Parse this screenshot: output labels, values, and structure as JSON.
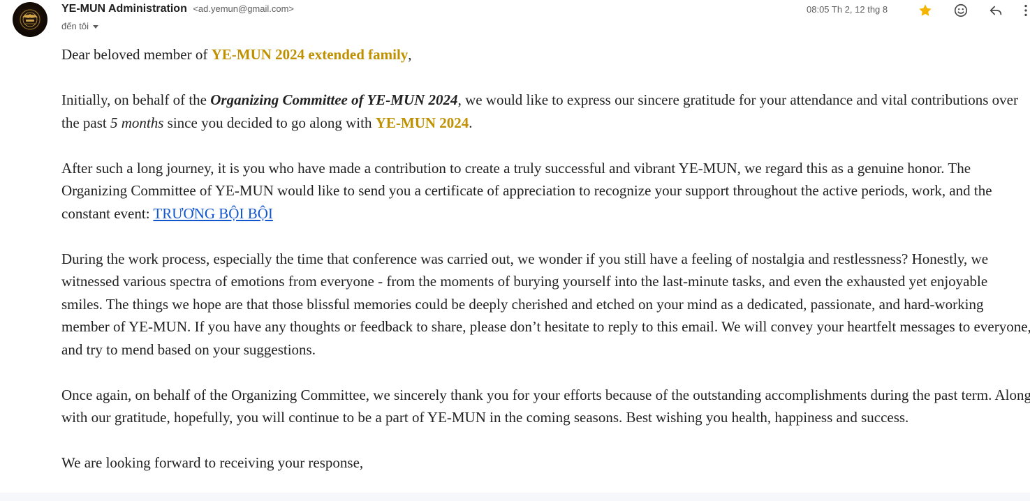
{
  "header": {
    "sender_name": "YE-MUN Administration",
    "sender_email": "<ad.yemun@gmail.com>",
    "recipient_label": "đến tôi",
    "date": "08:05 Th 2, 12 thg 8",
    "avatar_icon": "ye-mun-logo",
    "actions": [
      "star-icon",
      "emoji-icon",
      "reply-icon",
      "more-vert-icon"
    ],
    "star_color": "#f4b400"
  },
  "body": {
    "greeting": {
      "pre": "Dear beloved member of ",
      "highlight": "YE-MUN 2024 extended family",
      "post": ","
    },
    "p1": {
      "a": "Initially, on behalf of the ",
      "b": "Organizing Committee of YE-MUN 2024",
      "c": ", we would like to express our sincere gratitude for your attendance and vital contributions over the past ",
      "d": "5 months",
      "e": " since you decided to go along with ",
      "f": "YE-MUN 2024",
      "g": "."
    },
    "p2": {
      "text": "After such a long journey, it is you who have made a contribution to create a truly successful and vibrant YE-MUN, we regard this as a genuine honor. The Organizing Committee of YE-MUN would like to send you a certificate of appreciation to recognize your support throughout the active periods, work, and the constant event: ",
      "link": "TRƯƠNG BỘI BỘI"
    },
    "p3": "During the work process, especially the time that conference was carried out, we wonder if you still have a feeling of nostalgia and restlessness? Honestly, we witnessed various spectra of emotions from everyone - from the moments of burying yourself into the last-minute tasks, and even the exhausted yet enjoyable smiles. The things we hope are that those blissful memories could be deeply cherished and etched on your mind as a dedicated, passionate, and hard-working member of YE-MUN. If you have any thoughts or feedback to share, please don’t hesitate to reply to this email. We will convey your heartfelt messages to everyone, and try to mend based on your suggestions.",
    "p4": "Once again, on behalf of the Organizing Committee, we sincerely thank you for your efforts because of the outstanding accomplishments during the past term. Along with our gratitude, hopefully, you will continue to be a part of YE-MUN in the coming seasons. Best wishing you health, happiness and success.",
    "p5": "We are looking forward to receiving your response,"
  },
  "colors": {
    "highlight_gold": "#bf9000",
    "link_blue": "#1155cc",
    "text": "#222222"
  }
}
